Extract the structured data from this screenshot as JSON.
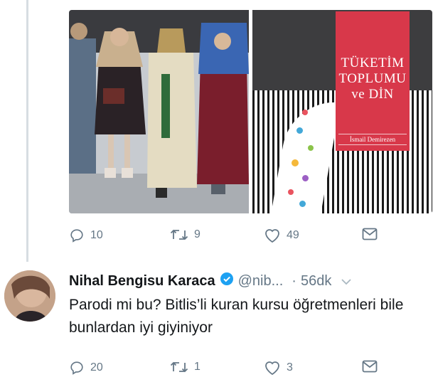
{
  "tweet1": {
    "media_left_desc": "runway-photo",
    "book_cover": {
      "title_line1": "TÜKETİM",
      "title_line2": "TOPLUMU",
      "title_line3": "ve DİN",
      "author": "İsmail Demirezen"
    },
    "actions": {
      "replies": "10",
      "retweets": "9",
      "likes": "49"
    }
  },
  "tweet2": {
    "display_name": "Nihal Bengisu Karaca",
    "handle": "@nib...",
    "separator": "·",
    "time": "56dk",
    "text": "Parodi mi bu? Bitlis’li kuran kursu öğretmenleri bile bunlardan iyi giyiniyor",
    "actions": {
      "replies": "20",
      "retweets": "1",
      "likes": "3"
    }
  },
  "colors": {
    "accent_verified": "#1da1f2",
    "muted": "#657786",
    "text": "#14171a",
    "cover_red": "#d8384a"
  },
  "icons": [
    "reply-icon",
    "retweet-icon",
    "like-icon",
    "message-icon",
    "verified-icon",
    "chevron-down-icon"
  ]
}
